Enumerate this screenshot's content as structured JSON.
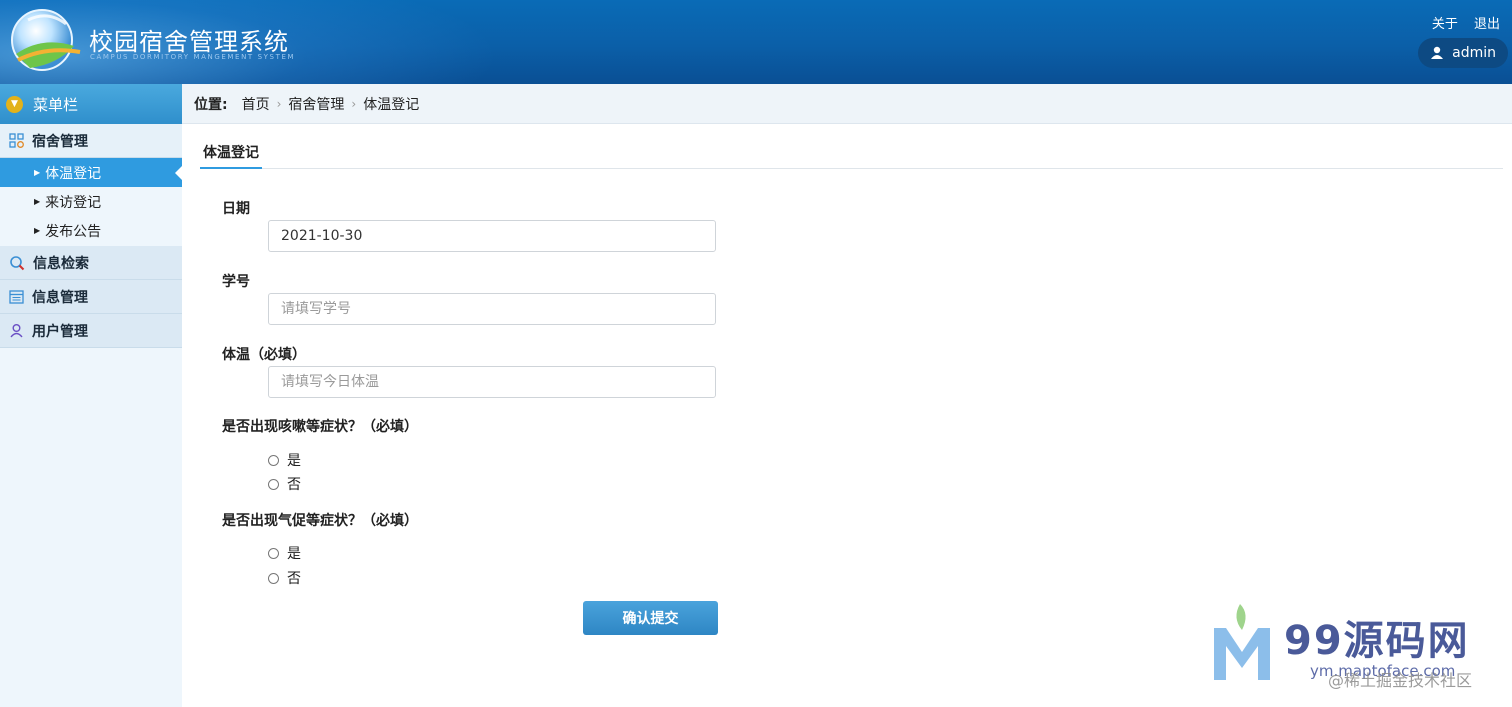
{
  "header": {
    "title": "校园宿舍管理系统",
    "subtitle": "CAMPUS DORMITORY MANGEMENT SYSTEM",
    "links": [
      "关于",
      "退出"
    ],
    "user": "admin"
  },
  "sidebar": {
    "menu_title": "菜单栏",
    "groups": [
      {
        "label": "宿舍管理",
        "icon": "grid-icon",
        "items": [
          "体温登记",
          "来访登记",
          "发布公告"
        ]
      },
      {
        "label": "信息检索",
        "icon": "search-icon"
      },
      {
        "label": "信息管理",
        "icon": "list-icon"
      },
      {
        "label": "用户管理",
        "icon": "user-icon"
      }
    ],
    "active_item": "体温登记"
  },
  "breadcrumb": {
    "label": "位置:",
    "items": [
      "首页",
      "宿舍管理",
      "体温登记"
    ]
  },
  "tab": "体温登记",
  "form": {
    "date_label": "日期",
    "date_value": "2021-10-30",
    "sid_label": "学号",
    "sid_placeholder": "请填写学号",
    "temp_label": "体温（必填）",
    "temp_placeholder": "请填写今日体温",
    "q1_label": "是否出现咳嗽等症状？（必填）",
    "q2_label": "是否出现气促等症状？（必填）",
    "yes": "是",
    "no": "否",
    "submit": "确认提交"
  },
  "watermark": {
    "brand": "99源码网",
    "url": "ym.maptoface.com",
    "credit": "@稀土掘金技术社区"
  },
  "colors": {
    "header": "#0b5fa8",
    "active": "#2f9be0",
    "submit": "#3a93d0"
  }
}
